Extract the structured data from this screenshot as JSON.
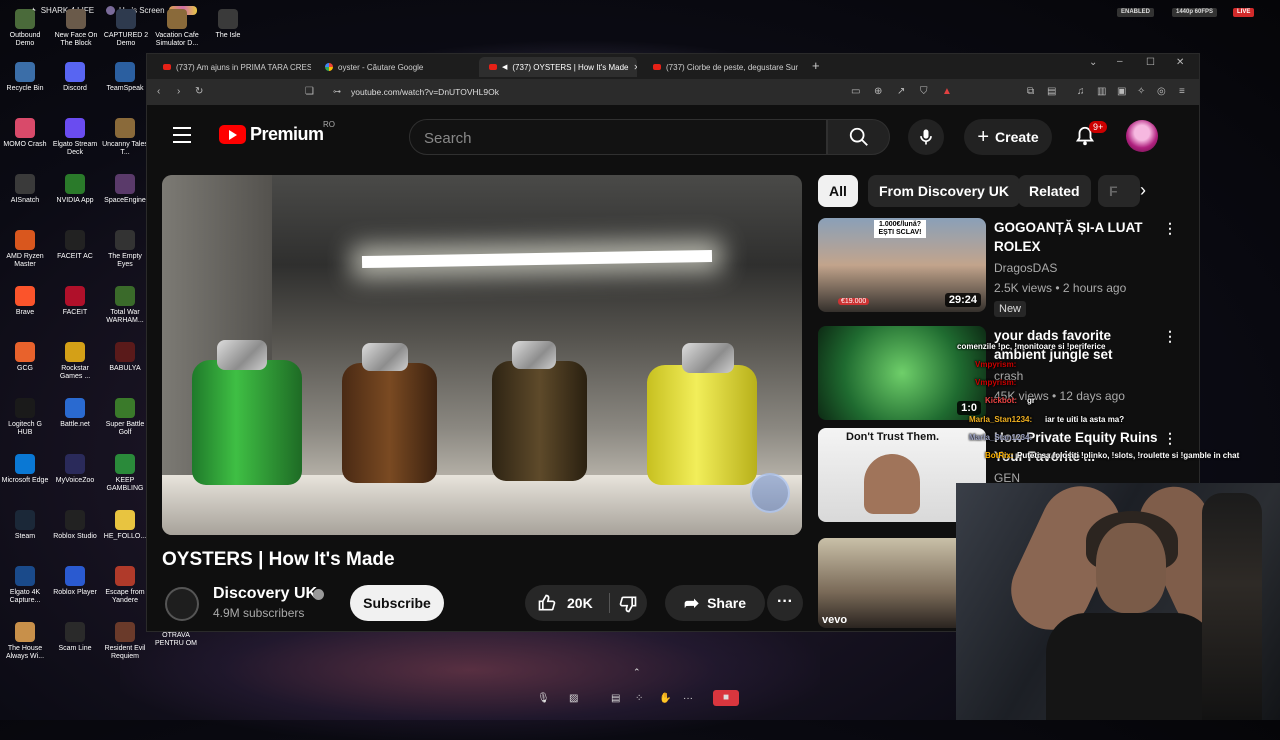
{
  "top_bar": {
    "left_items": [
      "SHARK 4 LIFE",
      "H...'s Screen"
    ],
    "right_pills": [
      "ENABLED",
      "1440p 60FPS",
      "LIVE"
    ]
  },
  "desktop_top_icons": [
    "Outbound Demo",
    "New Face On The Block",
    "CAPTURED 2 Demo",
    "Vacation Cafe Simulator D...",
    "The Isle"
  ],
  "desktop_icons": [
    [
      "Recycle Bin",
      "Discord",
      "TeamSpeak"
    ],
    [
      "MOMO Crash",
      "Elgato Stream Deck",
      "Uncanny Tales T..."
    ],
    [
      "AISnatch",
      "NVIDIA App",
      "SpaceEngine"
    ],
    [
      "AMD Ryzen Master",
      "FACEIT AC",
      "The Empty Eyes"
    ],
    [
      "Brave",
      "FACEIT",
      "Total War WARHAM..."
    ],
    [
      "GCG",
      "Rockstar Games ...",
      "BABULYA"
    ],
    [
      "Logitech G HUB",
      "Battle.net",
      "Super Battle Golf"
    ],
    [
      "Microsoft Edge",
      "MyVoiceZoo",
      "KEEP GAMBLING"
    ],
    [
      "Steam",
      "Roblox Studio",
      "HE_FOLLO..."
    ],
    [
      "Elgato 4K Capture...",
      "Roblox Player",
      "Escape from Yandere"
    ],
    [
      "The House Always Wi...",
      "Scam Line",
      "Resident Evil Requiem"
    ]
  ],
  "desktop_extra_label": "OTRAVA PENTRU OM",
  "browser": {
    "tabs": [
      {
        "label": "(737) Am ajuns in PRIMA TARA CRES",
        "icon": "youtube-icon"
      },
      {
        "label": "oyster - Căutare Google",
        "icon": "google-icon"
      },
      {
        "label": "(737) OYSTERS | How It's Made",
        "icon": "youtube-icon",
        "active": true
      },
      {
        "label": "(737) Ciorbe de peste, degustare Sur",
        "icon": "youtube-icon"
      }
    ],
    "url": "youtube.com/watch?v=DnUTOVHL9Ok"
  },
  "youtube": {
    "logo_text": "Premium",
    "region": "RO",
    "search_placeholder": "Search",
    "create_label": "Create",
    "notification_count": "9+",
    "video": {
      "title": "OYSTERS | How It's Made",
      "channel": "Discovery UK",
      "subscribers": "4.9M subscribers",
      "subscribe_label": "Subscribe",
      "likes": "20K",
      "share_label": "Share"
    },
    "chips": [
      "All",
      "From Discovery UK",
      "Related",
      "F"
    ],
    "recommendations": [
      {
        "title": "GOGOANȚĂ ȘI-A LUAT ROLEX",
        "channel": "DragosDAS",
        "meta": "2.5K views • 2 hours ago",
        "duration": "29:24",
        "tag": "New",
        "thumb_text": "1.000€/lună? EȘTI SCLAV!",
        "thumb_price": "€19.000"
      },
      {
        "title": "your dads favorite ambient jungle set",
        "channel": "crash",
        "meta": "45K views • 12 days ago",
        "duration": "1:0"
      },
      {
        "title": "How Private Equity Ruins Your Favorite ...",
        "channel": "GEN",
        "meta": "",
        "duration": "2",
        "thumb_text": "Don't Trust Them."
      },
      {
        "title": "",
        "channel": "",
        "meta": "",
        "duration": "",
        "thumb_text": "vevo"
      }
    ]
  },
  "chat": [
    {
      "user": "",
      "text": "comenzile !pc, !monitoare si !periferice"
    },
    {
      "user": "Vmpyrism:",
      "text": ""
    },
    {
      "user": "Vmpyrism:",
      "text": ""
    },
    {
      "user": "Kickbot:",
      "text": "gr"
    },
    {
      "user": "Marla_Stan1234:",
      "text": "iar te uiti la asta ma?"
    },
    {
      "user": "Marla_Stan1234:",
      "text": ""
    },
    {
      "user": "BotRix:",
      "text": "Puteti sa folositi !plinko, !slots, !roulette si !gamble in chat"
    }
  ]
}
